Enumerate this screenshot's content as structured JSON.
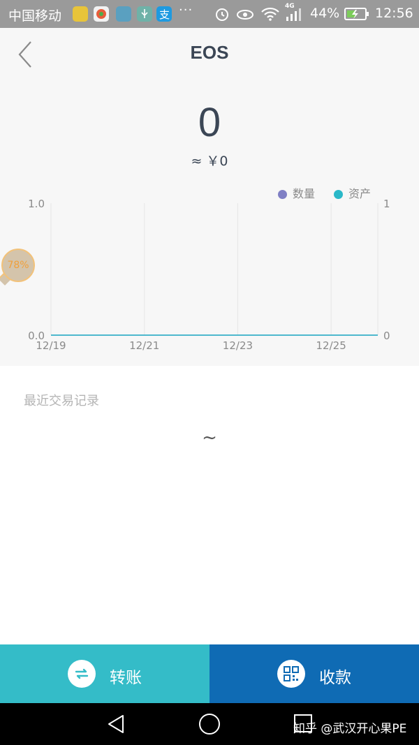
{
  "status_bar": {
    "carrier": "中国移动",
    "more_dots": "···",
    "network": "4G",
    "battery": "44%",
    "time": "12:56"
  },
  "header": {
    "title": "EOS"
  },
  "summary": {
    "balance": "0",
    "fiat_value": "≈ ￥0"
  },
  "chart_data": {
    "type": "line",
    "x": [
      "12/19",
      "12/21",
      "12/23",
      "12/25"
    ],
    "series": [
      {
        "name": "数量",
        "color": "#7f7fc4",
        "values": [
          0,
          0,
          0,
          0
        ]
      },
      {
        "name": "资产",
        "color": "#2ab8c8",
        "values": [
          0,
          0,
          0,
          0
        ]
      }
    ],
    "left_axis": {
      "ticks": [
        "0.0",
        "1.0"
      ],
      "ylim": [
        0,
        1
      ]
    },
    "right_axis": {
      "ticks": [
        "0",
        "1"
      ],
      "ylim": [
        0,
        1
      ]
    },
    "grid": true,
    "legend_position": "top-right"
  },
  "floating_widget": {
    "label": "78%"
  },
  "records": {
    "title": "最近交易记录",
    "empty_text": "~"
  },
  "actions": {
    "transfer_label": "转账",
    "receive_label": "收款"
  },
  "watermark": "知乎 @武汉开心果PE",
  "colors": {
    "transfer_bg": "#34bcc8",
    "receive_bg": "#0f6bb4",
    "status_bar_bg": "#9a9a9a"
  }
}
